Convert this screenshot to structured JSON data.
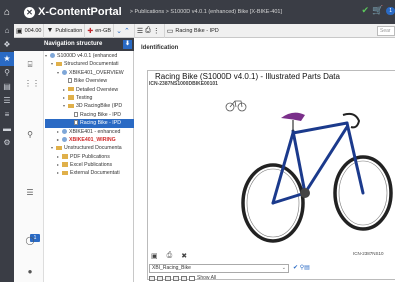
{
  "topbar": {
    "app_name": "X-ContentPortal",
    "breadcrumb": "> Publications > S1000D v4.0.1 (enhanced) Bike [X-BIKE-401]",
    "cart_count": "1"
  },
  "toolbar": {
    "issue": "004.00",
    "publication_label": "Publication",
    "language": "en-GB",
    "doc_title": "Racing Bike - IPD",
    "search_placeholder": "Sear"
  },
  "nav": {
    "title": "Navigation structure",
    "badge": "1",
    "tree": [
      {
        "label": "S1000D v4.0.1 (enhanced",
        "indent": 0,
        "icon": "pub",
        "expander": "▾"
      },
      {
        "label": "Structured Documentati",
        "indent": 1,
        "icon": "folder",
        "expander": "▾"
      },
      {
        "label": "XBIKE401_OVERVIEW",
        "indent": 2,
        "icon": "pub",
        "expander": "▾"
      },
      {
        "label": "Bike Overview",
        "indent": 3,
        "icon": "doc",
        "expander": ""
      },
      {
        "label": "Detailed Overview",
        "indent": 3,
        "icon": "folder",
        "expander": "▸"
      },
      {
        "label": "Testing",
        "indent": 3,
        "icon": "folder",
        "expander": "▸"
      },
      {
        "label": "3D RacingBike (IPD",
        "indent": 3,
        "icon": "folder",
        "expander": "▾"
      },
      {
        "label": "Racing Bike - IPD",
        "indent": 4,
        "icon": "doc",
        "expander": ""
      },
      {
        "label": "Racing Bike - IPD",
        "indent": 4,
        "icon": "doc",
        "expander": "",
        "selected": true
      },
      {
        "label": "XBIKE401 - enhanced",
        "indent": 2,
        "icon": "pub",
        "expander": "▸"
      },
      {
        "label": "XBIKE401_WIRING",
        "indent": 2,
        "icon": "pub",
        "expander": "▸",
        "red": true
      },
      {
        "label": "Unstructured Documenta",
        "indent": 1,
        "icon": "folder",
        "expander": "▾"
      },
      {
        "label": "PDF Publications",
        "indent": 2,
        "icon": "folder",
        "expander": "▸"
      },
      {
        "label": "Excel Publications",
        "indent": 2,
        "icon": "folder",
        "expander": "▸"
      },
      {
        "label": "External Documentati",
        "indent": 2,
        "icon": "folder",
        "expander": "▸"
      }
    ]
  },
  "content": {
    "section_title": "Identification",
    "viewer_title": "Racing Bike (S1000D v4.0.1) - Illustrated Parts Data",
    "icn_top": "ICN-2387NS1000DBIKE00101",
    "icn_bottom": "ICN-2387NS10",
    "select_value": "XBI_Racing_Bike",
    "show_all": "Show All"
  },
  "colors": {
    "accent": "#2a6ac4",
    "dark": "#3a3d45",
    "bike_frame": "#1b3a8c",
    "saddle": "#7a2f8a"
  }
}
